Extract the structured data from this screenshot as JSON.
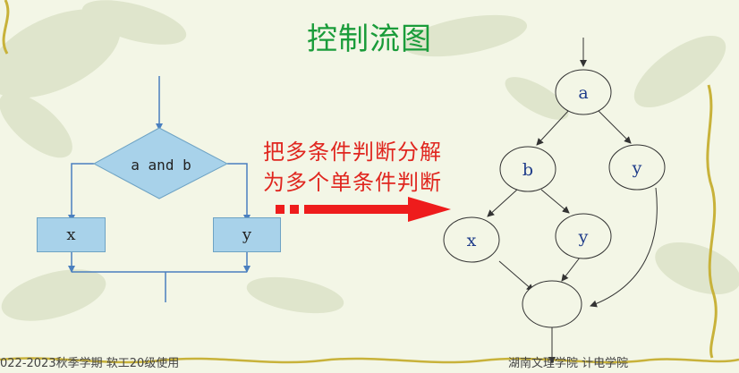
{
  "slide": {
    "title": "控制流图",
    "annotation_line1": "把多条件判断分解",
    "annotation_line2": "为多个单条件判断",
    "footer_left": "022-2023秋季学期 软工20级使用",
    "footer_right": "湖南文理学院 计电学院"
  },
  "flowchart": {
    "decision": "a and b",
    "left_box": "x",
    "right_box": "y"
  },
  "control_flow_graph": {
    "nodes": [
      "a",
      "b",
      "y",
      "x",
      "y",
      ""
    ]
  },
  "colors": {
    "title": "#1a9c3a",
    "annotation": "#e0261f",
    "flowchart_fill": "#a8d2ea",
    "flowchart_line": "#4a7fbf",
    "arrow": "#ee1c1c",
    "background": "#f3f6e6"
  }
}
